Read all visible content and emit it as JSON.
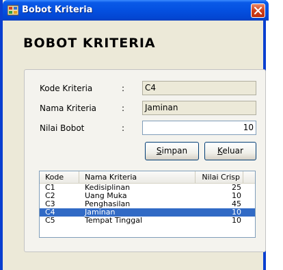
{
  "window": {
    "title": "Bobot Kriteria",
    "titlebar_color": "#0450e0",
    "close_color": "#d0401a"
  },
  "heading": "BOBOT KRITERIA",
  "form": {
    "kode_label": "Kode Kriteria",
    "kode_value": "C4",
    "nama_label": "Nama Kriteria",
    "nama_value": "Jaminan",
    "bobot_label": "Nilai Bobot",
    "bobot_value": "10",
    "colon": ":"
  },
  "buttons": {
    "simpan_accel": "S",
    "simpan_rest": "impan",
    "keluar_accel": "K",
    "keluar_rest": "eluar"
  },
  "table": {
    "columns": [
      "Kode",
      "Nama Kriteria",
      "Nilai Crisp"
    ],
    "rows": [
      {
        "kode": "C1",
        "nama": "Kedisiplinan",
        "nilai": "25",
        "selected": false
      },
      {
        "kode": "C2",
        "nama": "Uang Muka",
        "nilai": "10",
        "selected": false
      },
      {
        "kode": "C3",
        "nama": "Penghasilan",
        "nilai": "45",
        "selected": false
      },
      {
        "kode": "C4",
        "nama": "Jaminan",
        "nilai": "10",
        "selected": true
      },
      {
        "kode": "C5",
        "nama": "Tempat Tinggal",
        "nilai": "10",
        "selected": false
      }
    ],
    "selected_color": "#316ac5"
  }
}
